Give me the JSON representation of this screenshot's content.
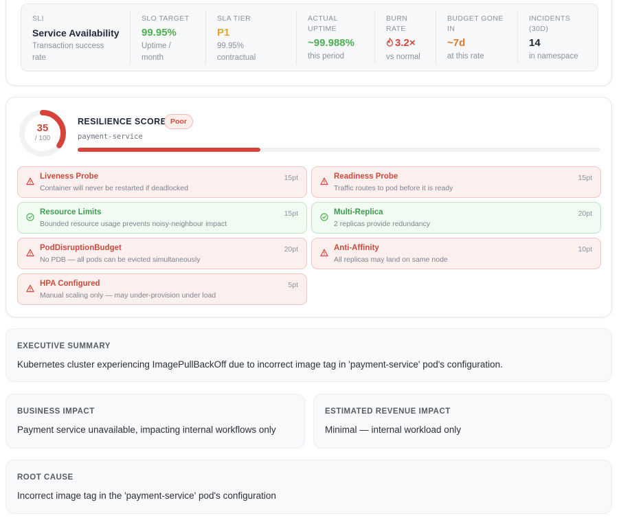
{
  "sli": {
    "columns": [
      {
        "label": "SLI",
        "value": "Service Availability",
        "sub": "Transaction success rate",
        "color": "#1f2937"
      },
      {
        "label": "SLO TARGET",
        "value": "99.95%",
        "sub": "Uptime / month",
        "color": "#4caf50"
      },
      {
        "label": "SLA TIER",
        "value": "P1",
        "sub": "99.95% contractual",
        "color": "#e0a52b"
      },
      {
        "label": "ACTUAL UPTIME",
        "value": "~99.988%",
        "sub": "this period",
        "color": "#4caf50"
      },
      {
        "label": "BURN RATE",
        "value": "3.2×",
        "sub": "vs normal",
        "color": "#d4443a",
        "icon": "flame-icon"
      },
      {
        "label": "BUDGET GONE IN",
        "value": "~7d",
        "sub": "at this rate",
        "color": "#e0782b"
      },
      {
        "label": "INCIDENTS (30D)",
        "value": "14",
        "sub": "in namespace",
        "color": "#1f2937"
      }
    ]
  },
  "resilience": {
    "score": 35,
    "score_max": "/ 100",
    "score_text": "35",
    "title": "RESILIENCE SCORE",
    "badge": "Poor",
    "service": "payment-service",
    "accent": "#d4443a",
    "checks": [
      {
        "name": "Liveness Probe",
        "desc": "Container will never be restarted if deadlocked",
        "points": "15pt",
        "status": "fail"
      },
      {
        "name": "Readiness Probe",
        "desc": "Traffic routes to pod before it is ready",
        "points": "15pt",
        "status": "fail"
      },
      {
        "name": "Resource Limits",
        "desc": "Bounded resource usage prevents noisy-neighbour impact",
        "points": "15pt",
        "status": "pass"
      },
      {
        "name": "Multi-Replica",
        "desc": "2 replicas provide redundancy",
        "points": "20pt",
        "status": "pass"
      },
      {
        "name": "PodDisruptionBudget",
        "desc": "No PDB — all pods can be evicted simultaneously",
        "points": "20pt",
        "status": "fail"
      },
      {
        "name": "Anti-Affinity",
        "desc": "All replicas may land on same node",
        "points": "10pt",
        "status": "fail"
      },
      {
        "name": "HPA Configured",
        "desc": "Manual scaling only — may under-provision under load",
        "points": "5pt",
        "status": "fail"
      }
    ]
  },
  "executive_summary": {
    "label": "EXECUTIVE SUMMARY",
    "text": "Kubernetes cluster experiencing ImagePullBackOff due to incorrect image tag in 'payment-service' pod's configuration."
  },
  "business_impact": {
    "label": "BUSINESS IMPACT",
    "text": "Payment service unavailable, impacting internal workflows only"
  },
  "revenue_impact": {
    "label": "ESTIMATED REVENUE IMPACT",
    "text": "Minimal — internal workload only"
  },
  "root_cause": {
    "label": "ROOT CAUSE",
    "text": "Incorrect image tag in the 'payment-service' pod's configuration"
  }
}
